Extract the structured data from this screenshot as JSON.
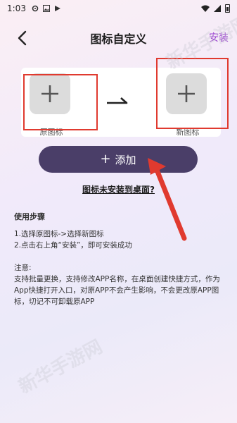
{
  "status": {
    "time": "1:03"
  },
  "nav": {
    "title": "图标自定义",
    "install": "安装"
  },
  "icons": {
    "old_label": "原图标",
    "new_label": "新图标"
  },
  "add_button": {
    "label": "添加"
  },
  "not_installed_link": "图标未安装到桌面?",
  "steps": {
    "title": "使用步骤",
    "items": [
      "1.选择原图标->选择新图标",
      "2.点击右上角“安装”，即可安装成功"
    ]
  },
  "note": {
    "title": "注意:",
    "text": "支持批量更换，支持修改APP名称，在桌面创建快捷方式，作为 App快捷打开入口，对原APP不会产生影响，不会更改原APP图标，切记不可卸载原APP"
  },
  "watermark": "新华手游网",
  "colors": {
    "accent": "#9a3fd0",
    "button": "#4a3e68",
    "annotation_red": "#e03a2f"
  }
}
